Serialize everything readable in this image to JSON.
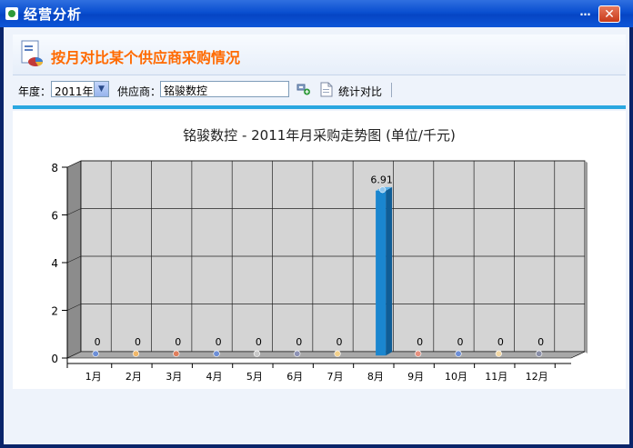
{
  "window": {
    "title": "经营分析",
    "minimize": "…",
    "close": "✕"
  },
  "header": {
    "title": "按月对比某个供应商采购情况"
  },
  "toolbar": {
    "year_label": "年度：",
    "year_value": "2011年",
    "supplier_label": "供应商：",
    "supplier_value": "铭骏数控",
    "compare_label": "统计对比"
  },
  "icons": {
    "app": "app-icon",
    "header": "report-chart-icon",
    "pick": "pick-supplier-icon",
    "stat": "document-icon",
    "dropdown": "chevron-down-icon"
  },
  "colors": {
    "accent_title": "#ff6a00",
    "divider": "#2aa7e0",
    "bar": "#1a86cf"
  },
  "chart_data": {
    "type": "bar",
    "title": "铭骏数控 - 2011年月采购走势图 (单位/千元)",
    "categories": [
      "1月",
      "2月",
      "3月",
      "4月",
      "5月",
      "6月",
      "7月",
      "8月",
      "9月",
      "10月",
      "11月",
      "12月"
    ],
    "values": [
      0,
      0,
      0,
      0,
      0,
      0,
      0,
      6.91,
      0,
      0,
      0,
      0
    ],
    "value_labels": [
      "0",
      "0",
      "0",
      "0",
      "0",
      "0",
      "0",
      "6.91",
      "0",
      "0",
      "0",
      "0"
    ],
    "yticks": [
      "0",
      "2",
      "4",
      "6",
      "8"
    ],
    "ylim": [
      0,
      8
    ],
    "grid": true,
    "marker_colors": [
      "#6d8fd8",
      "#f1b869",
      "#e07e5c",
      "#6d8fd8",
      "#c9c9c9",
      "#8e93b6",
      "#f3d18c",
      "#1a86cf",
      "#e8917f",
      "#6d8fd8",
      "#f3d8a6",
      "#8a8fa8"
    ]
  }
}
